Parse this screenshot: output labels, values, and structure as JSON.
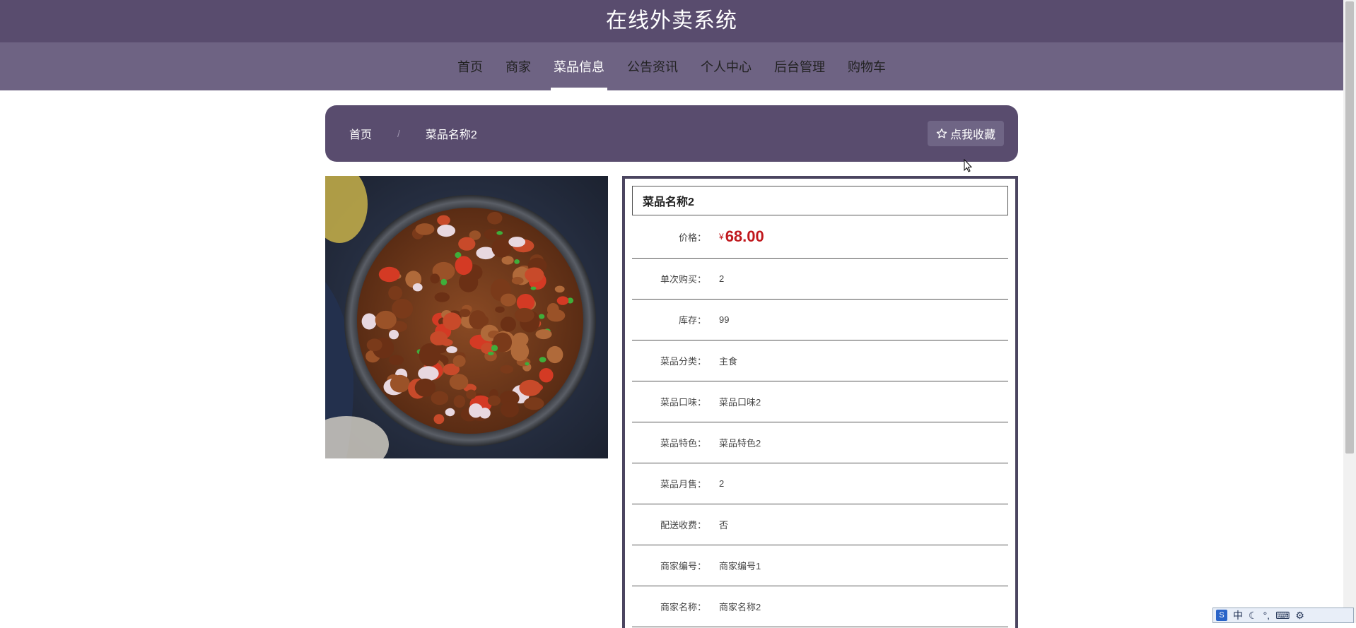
{
  "header": {
    "title": "在线外卖系统"
  },
  "nav": [
    {
      "label": "首页",
      "active": false
    },
    {
      "label": "商家",
      "active": false
    },
    {
      "label": "菜品信息",
      "active": true
    },
    {
      "label": "公告资讯",
      "active": false
    },
    {
      "label": "个人中心",
      "active": false
    },
    {
      "label": "后台管理",
      "active": false
    },
    {
      "label": "购物车",
      "active": false
    }
  ],
  "breadcrumb": {
    "home": "首页",
    "separator": "/",
    "current": "菜品名称2"
  },
  "favorite_button": {
    "icon": "star-outline-icon",
    "label": "点我收藏"
  },
  "product": {
    "name": "菜品名称2",
    "price_label": "价格：",
    "currency": "¥",
    "price": "68.00",
    "fields": [
      {
        "label": "单次购买：",
        "value": "2"
      },
      {
        "label": "库存：",
        "value": "99"
      },
      {
        "label": "菜品分类：",
        "value": "主食"
      },
      {
        "label": "菜品口味：",
        "value": "菜品口味2"
      },
      {
        "label": "菜品特色：",
        "value": "菜品特色2"
      },
      {
        "label": "菜品月售：",
        "value": "2"
      },
      {
        "label": "配送收费：",
        "value": "否"
      },
      {
        "label": "商家编号：",
        "value": "商家编号1"
      },
      {
        "label": "商家名称：",
        "value": "商家名称2"
      }
    ]
  },
  "ime": {
    "mode": "中"
  },
  "colors": {
    "header_bg": "#594c6e",
    "nav_bg": "#6e6383",
    "price": "#c0181d"
  }
}
